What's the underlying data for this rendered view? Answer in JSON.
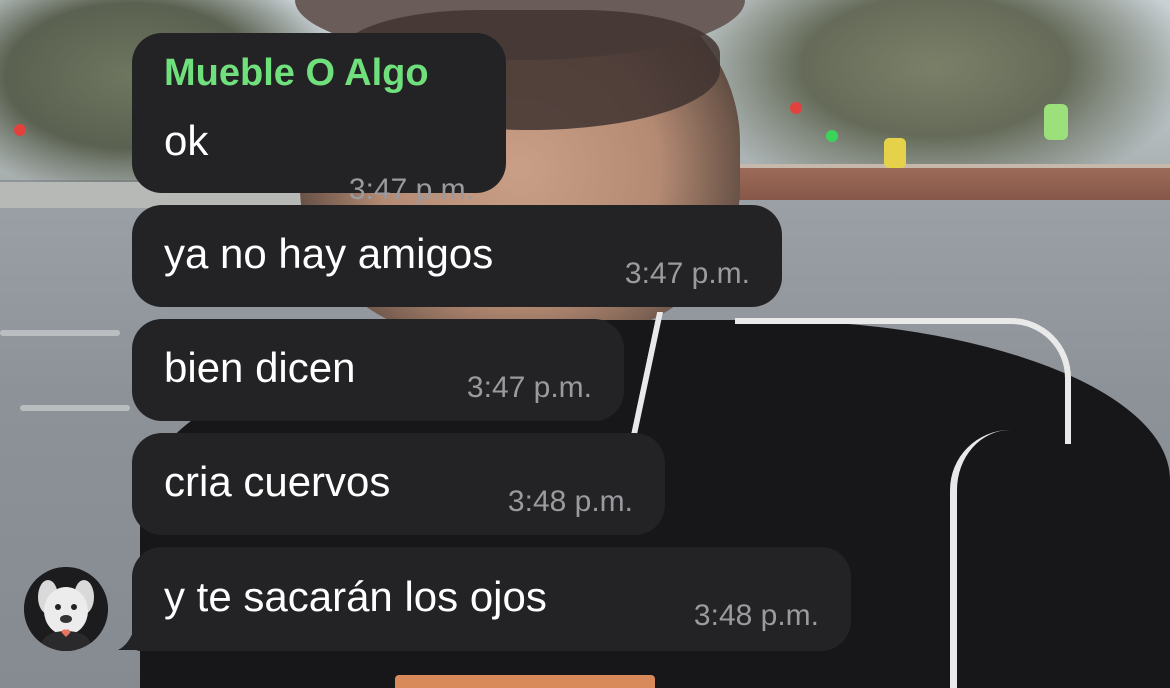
{
  "chat": {
    "sender_name": "Mueble O Algo",
    "sender_color": "#6fe07c",
    "messages": [
      {
        "text": "ok",
        "time": "3:47 p.m."
      },
      {
        "text": "ya no hay amigos",
        "time": "3:47 p.m."
      },
      {
        "text": "bien dicen",
        "time": "3:47 p.m."
      },
      {
        "text": "cria cuervos",
        "time": "3:48 p.m."
      },
      {
        "text": "y te sacarán los ojos",
        "time": "3:48 p.m."
      }
    ],
    "avatar_icon": "plush-toy-avatar-icon",
    "bubble_color": "#232325"
  }
}
